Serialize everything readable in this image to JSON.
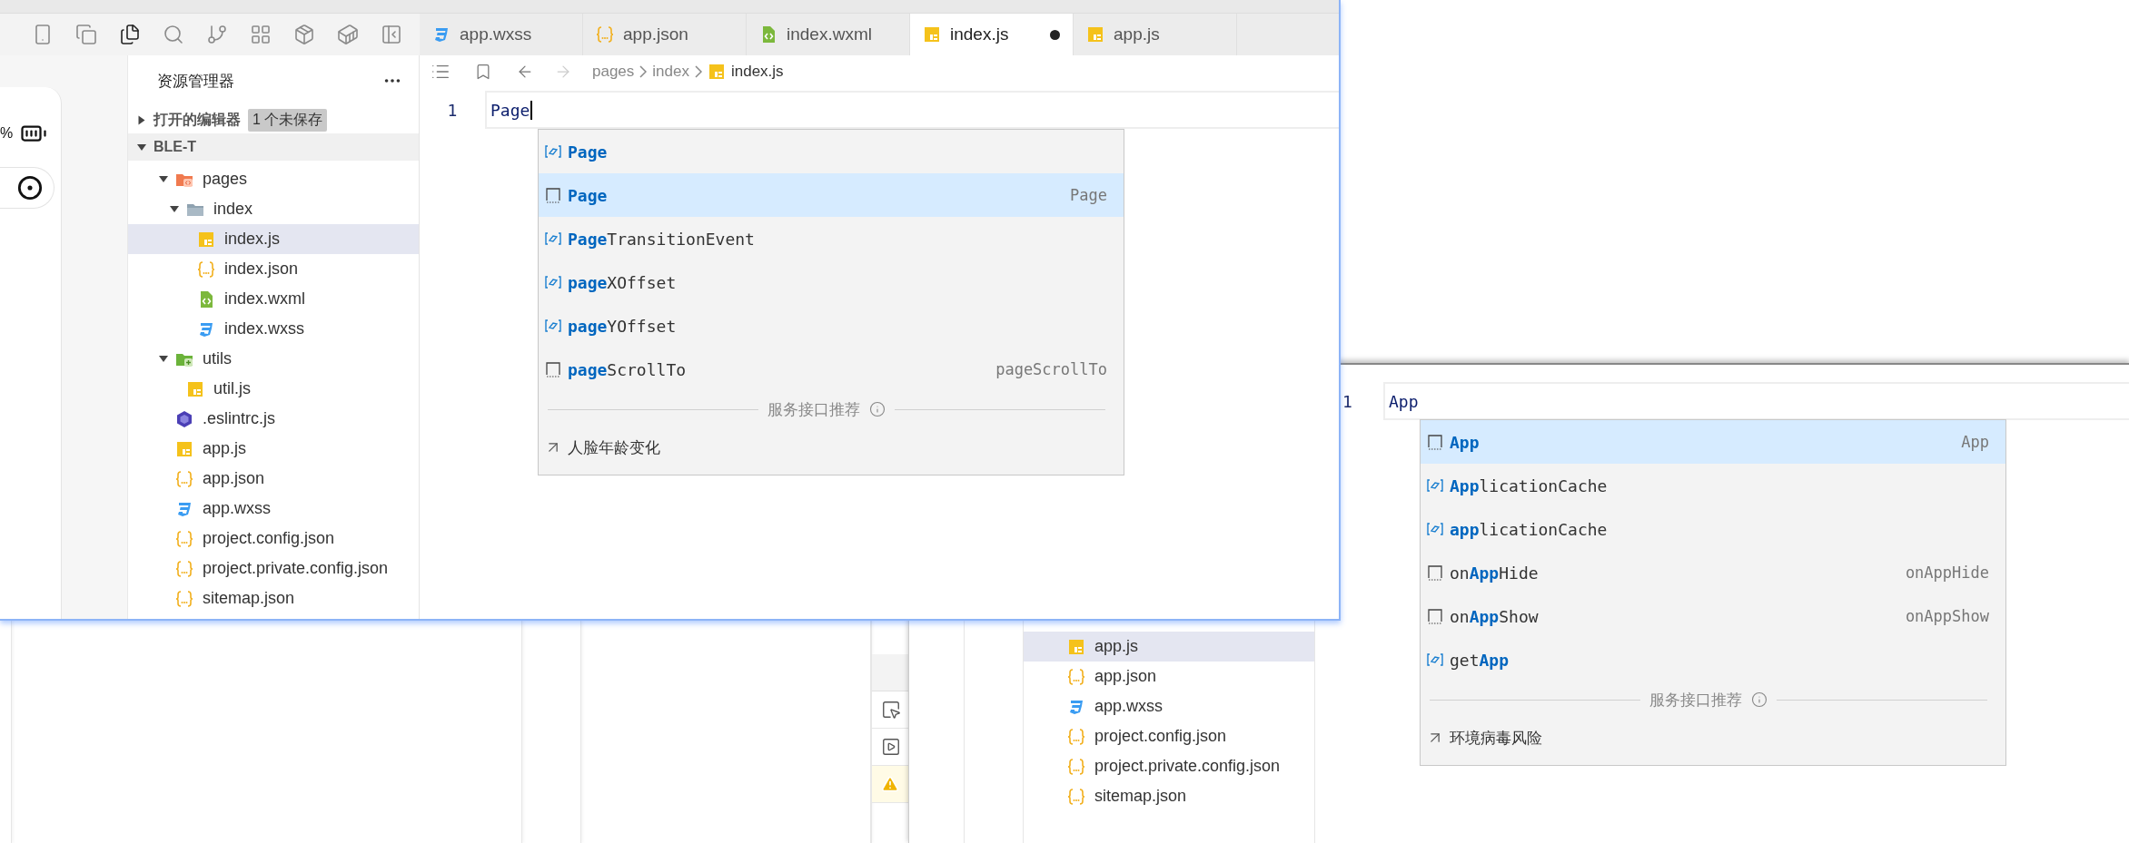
{
  "front_window": {
    "activity_bar": [
      {
        "kind": "phone",
        "selected": false
      },
      {
        "kind": "windows",
        "selected": false
      },
      {
        "kind": "files",
        "selected": true
      },
      {
        "kind": "search",
        "selected": false
      },
      {
        "kind": "branch",
        "selected": false
      },
      {
        "kind": "extensions",
        "selected": false
      },
      {
        "kind": "box",
        "selected": false
      },
      {
        "kind": "docker",
        "selected": false
      },
      {
        "kind": "panel",
        "selected": false
      }
    ],
    "tabs": [
      {
        "label": "app.wxss",
        "kind": "wxss",
        "selected": false,
        "unsaved": false
      },
      {
        "label": "app.json",
        "kind": "json",
        "selected": false,
        "unsaved": false
      },
      {
        "label": "index.wxml",
        "kind": "wxml",
        "selected": false,
        "unsaved": false
      },
      {
        "label": "index.js",
        "kind": "js",
        "selected": true,
        "unsaved": true
      },
      {
        "label": "app.js",
        "kind": "js",
        "selected": false,
        "unsaved": false
      }
    ],
    "simulator": {
      "battery_text": "%"
    },
    "explorer": {
      "title": "资源管理器",
      "open_editors": {
        "label": "打开的编辑器",
        "badge": "1 个未保存",
        "expanded": false
      },
      "project": {
        "label": "BLE-T",
        "expanded": true
      },
      "tree": [
        {
          "name": "pages",
          "kind": "folder-pages",
          "expanded": true,
          "selected": false,
          "children": [
            {
              "name": "index",
              "kind": "folder",
              "expanded": true,
              "selected": false,
              "children": [
                {
                  "name": "index.js",
                  "kind": "js",
                  "selected": true
                },
                {
                  "name": "index.json",
                  "kind": "json",
                  "selected": false
                },
                {
                  "name": "index.wxml",
                  "kind": "wxml",
                  "selected": false
                },
                {
                  "name": "index.wxss",
                  "kind": "wxss",
                  "selected": false
                }
              ]
            }
          ]
        },
        {
          "name": "utils",
          "kind": "folder-utils",
          "expanded": true,
          "selected": false,
          "children": [
            {
              "name": "util.js",
              "kind": "js",
              "selected": false
            }
          ]
        },
        {
          "name": ".eslintrc.js",
          "kind": "eslint",
          "selected": false
        },
        {
          "name": "app.js",
          "kind": "js",
          "selected": false
        },
        {
          "name": "app.json",
          "kind": "json",
          "selected": false
        },
        {
          "name": "app.wxss",
          "kind": "wxss",
          "selected": false
        },
        {
          "name": "project.config.json",
          "kind": "json",
          "selected": false
        },
        {
          "name": "project.private.config.json",
          "kind": "json",
          "selected": false
        },
        {
          "name": "sitemap.json",
          "kind": "json",
          "selected": false
        }
      ]
    },
    "breadcrumb": [
      {
        "label": "pages",
        "kind": "folder"
      },
      {
        "label": "index",
        "kind": "folder"
      },
      {
        "label": "index.js",
        "kind": "js"
      }
    ],
    "editor": {
      "line_number": "1",
      "code": "Page"
    },
    "suggestions": {
      "items": [
        {
          "kind": "variable",
          "match": "Page",
          "selected": false
        },
        {
          "kind": "snippet",
          "match": "Page",
          "detail": "Page",
          "selected": true
        },
        {
          "kind": "variable",
          "match": "Page",
          "after": "TransitionEvent",
          "selected": false
        },
        {
          "kind": "variable",
          "match": "page",
          "after": "XOffset",
          "selected": false
        },
        {
          "kind": "variable",
          "match": "page",
          "after": "YOffset",
          "selected": false
        },
        {
          "kind": "snippet",
          "match": "page",
          "after": "ScrollTo",
          "detail": "pageScrollTo",
          "selected": false
        }
      ],
      "section": "服务接口推荐",
      "service": "人脸年龄变化"
    }
  },
  "back_window": {
    "explorer": [
      {
        "name": "app.js",
        "kind": "js",
        "selected": true
      },
      {
        "name": "app.json",
        "kind": "json",
        "selected": false
      },
      {
        "name": "app.wxss",
        "kind": "wxss",
        "selected": false
      },
      {
        "name": "project.config.json",
        "kind": "json",
        "selected": false
      },
      {
        "name": "project.private.config.json",
        "kind": "json",
        "selected": false
      },
      {
        "name": "sitemap.json",
        "kind": "json",
        "selected": false
      }
    ],
    "editor": {
      "line_number": "1",
      "code": "App"
    },
    "suggestions": {
      "items": [
        {
          "kind": "snippet",
          "match": "App",
          "detail": "App",
          "selected": true
        },
        {
          "kind": "variable",
          "match": "App",
          "after": "licationCache",
          "selected": false
        },
        {
          "kind": "variable",
          "match": "app",
          "after": "licationCache",
          "selected": false
        },
        {
          "kind": "snippet",
          "before": "on",
          "match": "App",
          "after": "Hide",
          "detail": "onAppHide",
          "selected": false
        },
        {
          "kind": "snippet",
          "before": "on",
          "match": "App",
          "after": "Show",
          "detail": "onAppShow",
          "selected": false
        },
        {
          "kind": "variable",
          "before": "get",
          "match": "App",
          "selected": false
        }
      ],
      "section": "服务接口推荐",
      "service": "环境病毒风险"
    }
  }
}
